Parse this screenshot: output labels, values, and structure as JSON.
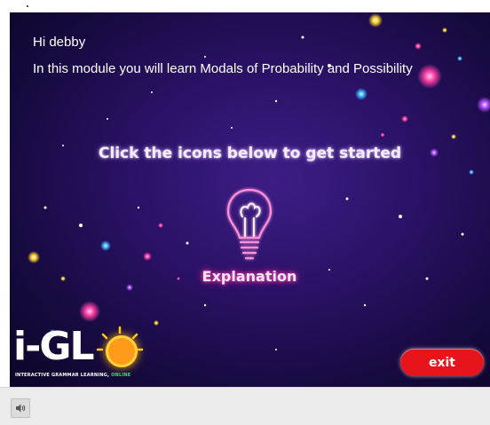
{
  "greeting": "Hi debby",
  "intro": "In this module you will learn Modals of Probability and Possibility",
  "cta": "Click the icons below to get started",
  "explanation_label": "Explanation",
  "exit_label": "exit",
  "logo": {
    "wordmark": "i-GL",
    "tagline_main": "INTERACTIVE GRAMMAR LEARNING,",
    "tagline_online": "ONLINE"
  },
  "icons": {
    "explanation": "lightbulb-icon",
    "audio": "speaker-icon"
  },
  "colors": {
    "background": "#2a1266",
    "exit_button": "#e8141b",
    "explanation_glow": "#ff5cc8",
    "logo_orange": "#ff9a1a",
    "online_green": "#37e06a"
  }
}
